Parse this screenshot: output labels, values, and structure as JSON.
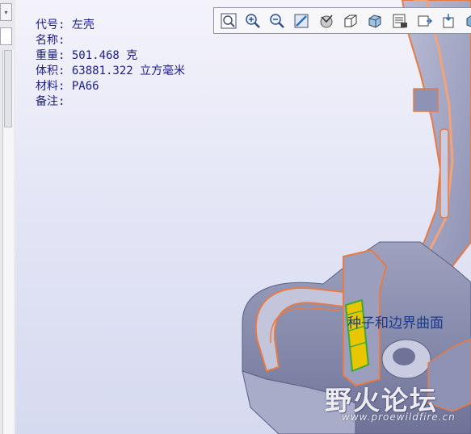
{
  "part_info": {
    "code": "代号: 左壳",
    "name": "名称:",
    "weight": "重量: 501.468 克",
    "volume": "体积: 63881.322 立方毫米",
    "material": "材料: PA66",
    "remarks": "备注:"
  },
  "toolbar": {
    "buttons": [
      {
        "name": "zoom-fit-icon"
      },
      {
        "name": "zoom-in-icon"
      },
      {
        "name": "zoom-out-icon"
      },
      {
        "name": "repaint-icon"
      },
      {
        "name": "spin-center-icon"
      },
      {
        "name": "display-style-icon"
      },
      {
        "name": "saved-views-icon"
      },
      {
        "name": "view-manager-icon"
      },
      {
        "name": "datum-display-icon"
      },
      {
        "name": "annotation-display-icon"
      },
      {
        "name": "appearance-icon"
      }
    ]
  },
  "model": {
    "annotation_label": "种子和边界曲面"
  },
  "watermark": {
    "text": "野火论坛",
    "url": "www.proewildfire.cn"
  },
  "colors": {
    "info_text": "#1c1c84",
    "annotation_text": "#1b3a8a",
    "part_edge": "#e87a45",
    "part_fill": "#a9acc8",
    "seed_surface": "#e8c600",
    "seed_edge": "#3aa83a"
  }
}
